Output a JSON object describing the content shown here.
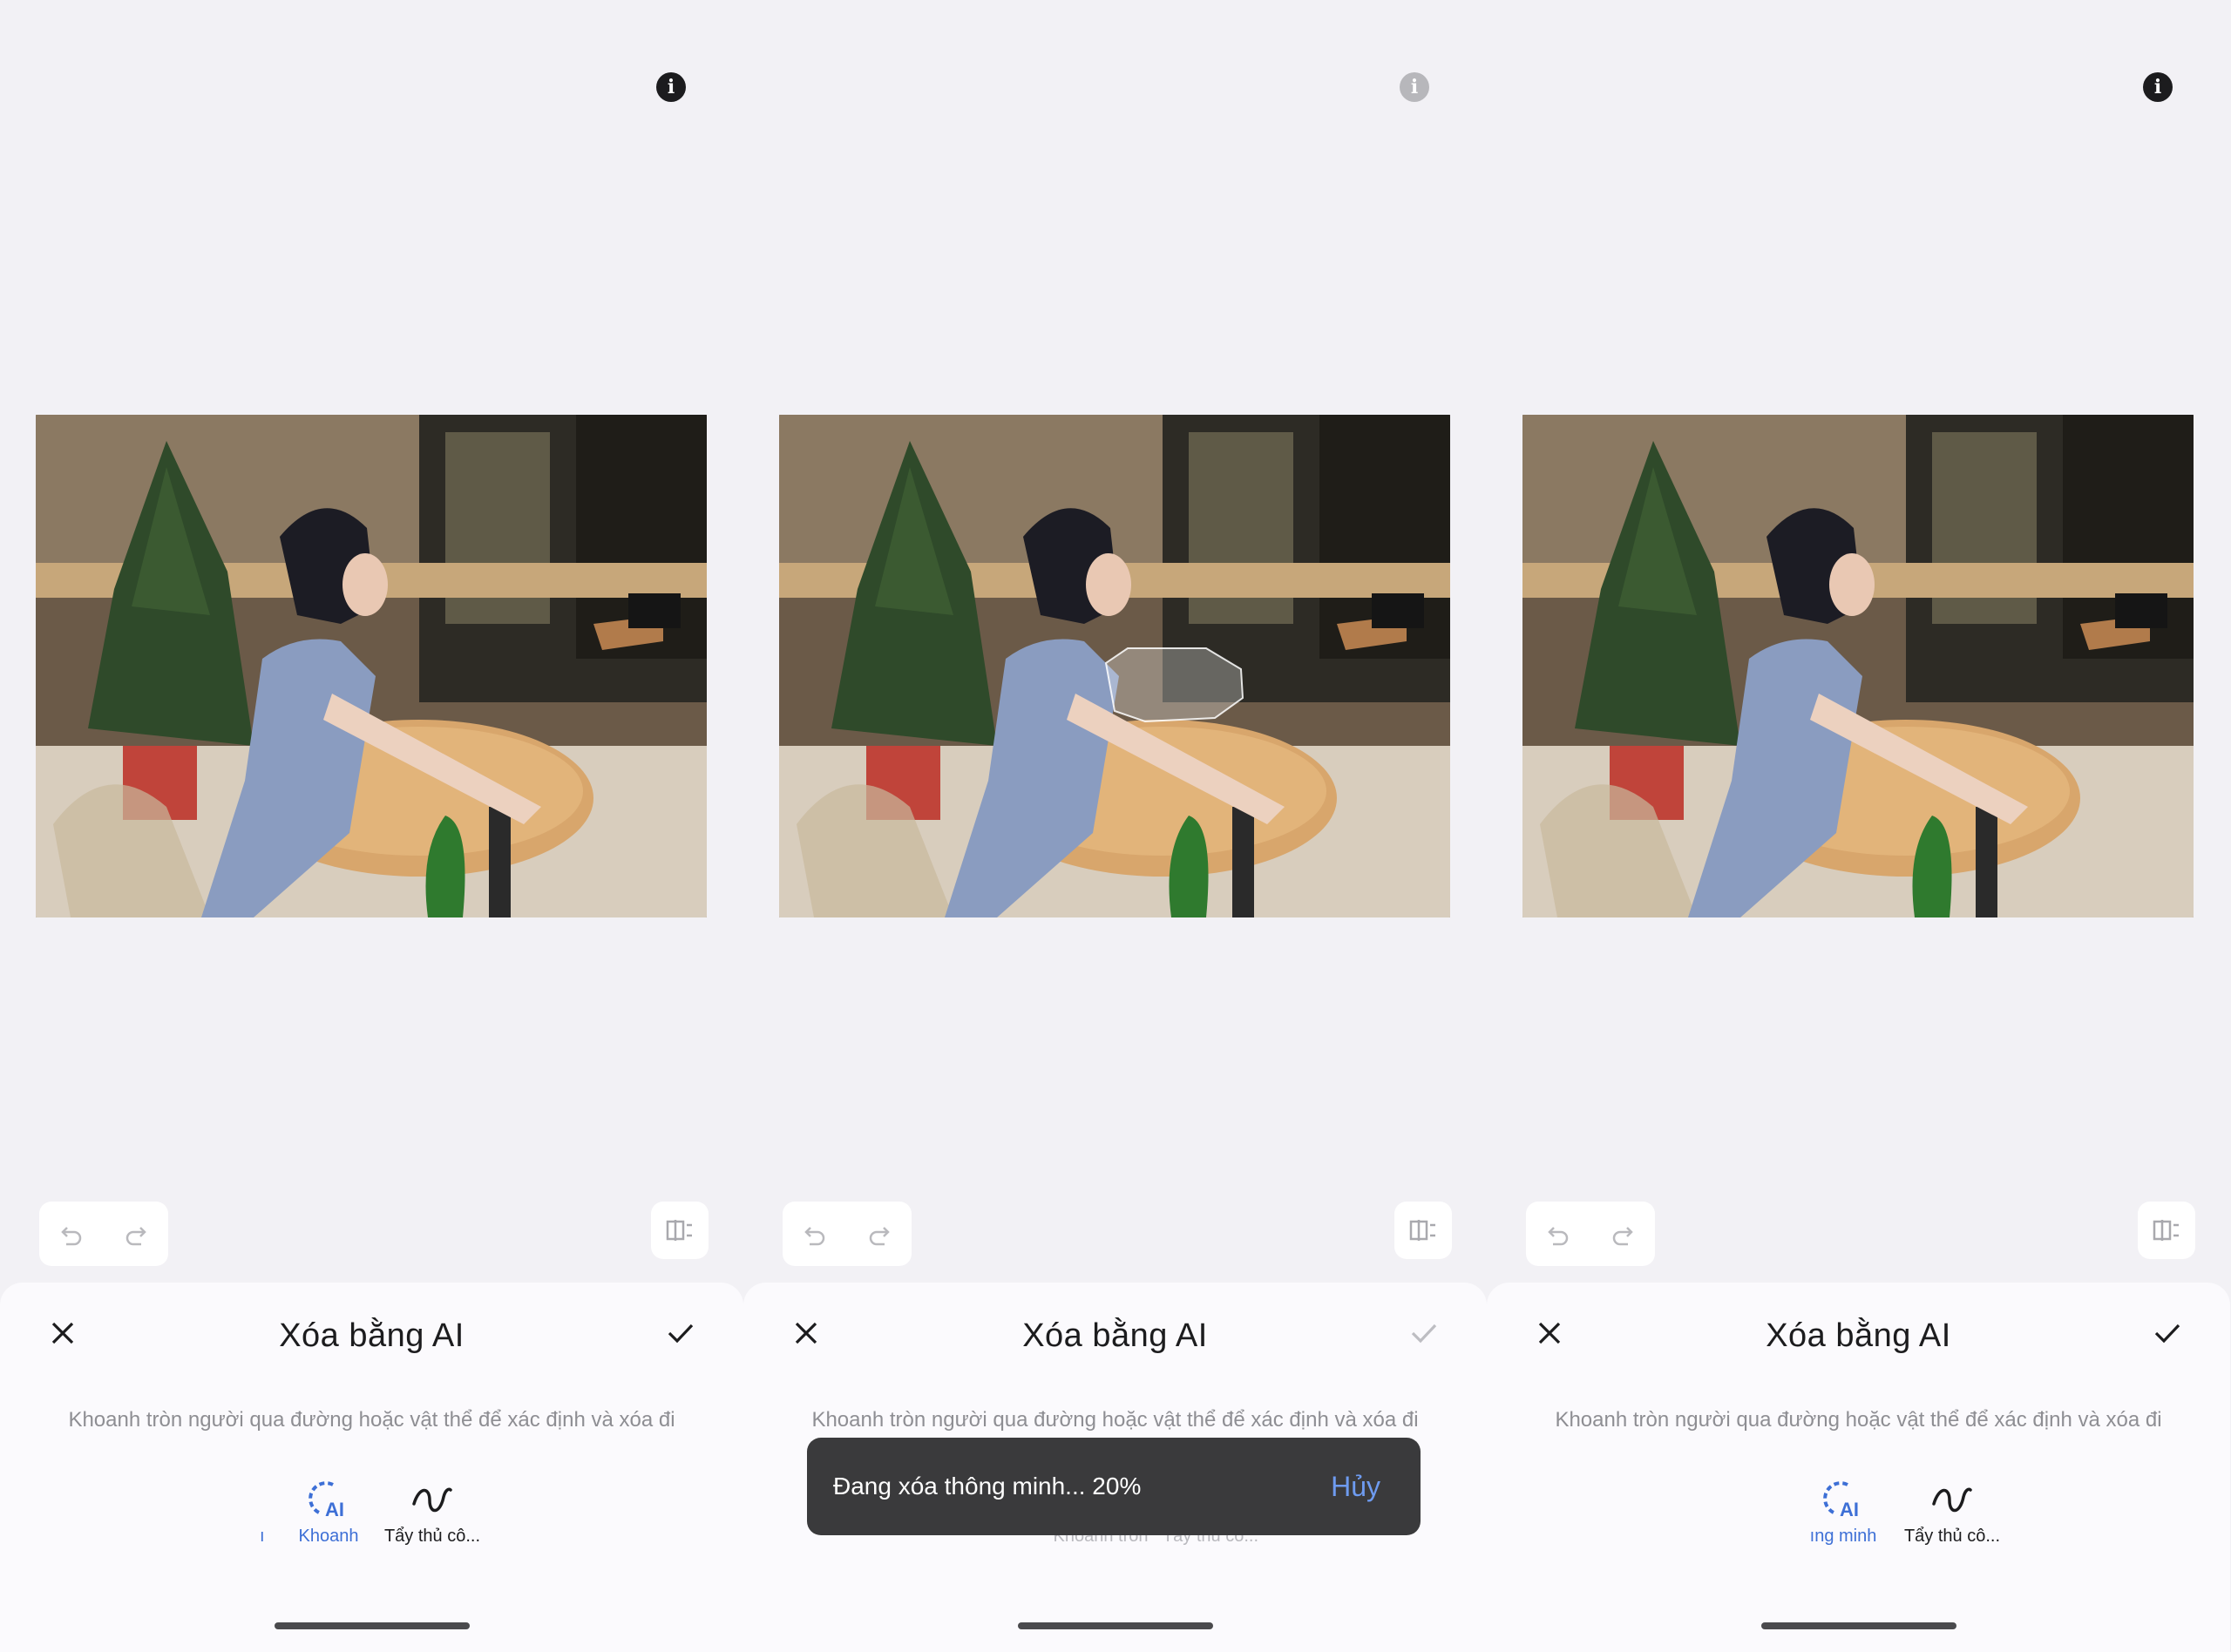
{
  "screens": [
    {
      "info_icon": "info-icon",
      "sheet": {
        "title": "Xóa bằng AI",
        "hint": "Khoanh tròn người qua đường hoặc vật thể để xác định và xóa đi",
        "tools": [
          {
            "label": "Khoanh",
            "icon": "ai-lasso-icon",
            "active": true
          },
          {
            "label": "Tẩy thủ cô...",
            "icon": "brush-stroke-icon",
            "active": false
          }
        ],
        "left_fragment": "ı"
      }
    },
    {
      "info_icon": "info-icon",
      "sheet": {
        "title": "Xóa bằng AI",
        "hint": "Khoanh tròn người qua đường hoặc vật thể để xác định và xóa đi",
        "tools": [
          {
            "label": "Khoanh tròn",
            "icon": "ai-lasso-icon",
            "active": false
          },
          {
            "label": "Tẩy thủ cô...",
            "icon": "brush-stroke-icon",
            "active": false
          }
        ]
      },
      "toast": {
        "text": "Đang xóa thông minh... 20%",
        "cancel": "Hủy",
        "progress_percent": 20
      }
    },
    {
      "info_icon": "info-icon",
      "sheet": {
        "title": "Xóa bằng AI",
        "hint": "Khoanh tròn người qua đường hoặc vật thể để xác định và xóa đi",
        "tools": [
          {
            "label": "ıng minh",
            "icon": "ai-lasso-icon",
            "active": true
          },
          {
            "label": "Tẩy thủ cô...",
            "icon": "brush-stroke-icon",
            "active": false
          }
        ]
      }
    }
  ],
  "colors": {
    "background": "#f2f1f5",
    "sheet": "#fbfafd",
    "accent": "#3d6fd6",
    "toast": "#3a3a3c"
  }
}
